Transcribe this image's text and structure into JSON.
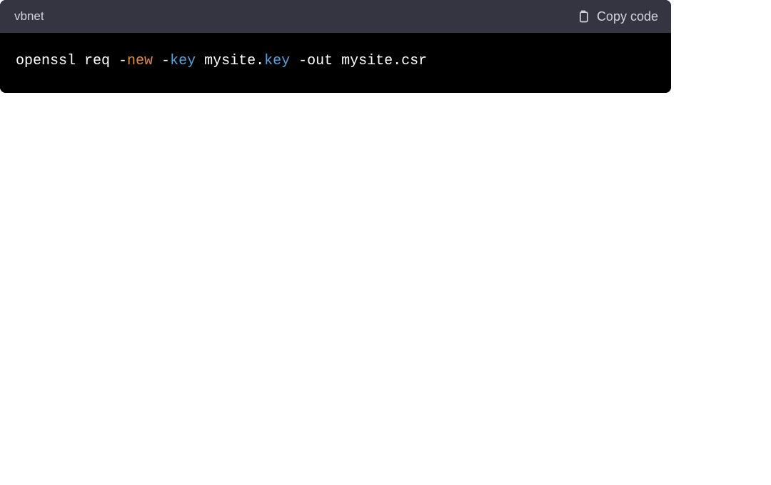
{
  "header": {
    "language": "vbnet",
    "copyLabel": "Copy code"
  },
  "code": {
    "tokens": {
      "t0": "openssl req -",
      "t1": "new",
      "t2": " -",
      "t3": "key",
      "t4": " mysite.",
      "t5": "key",
      "t6": " -out mysite.csr"
    },
    "syntaxColors": {
      "keyword1": "#e38c3f",
      "keyword2": "#4fa5e0",
      "default": "#ffffff"
    }
  }
}
